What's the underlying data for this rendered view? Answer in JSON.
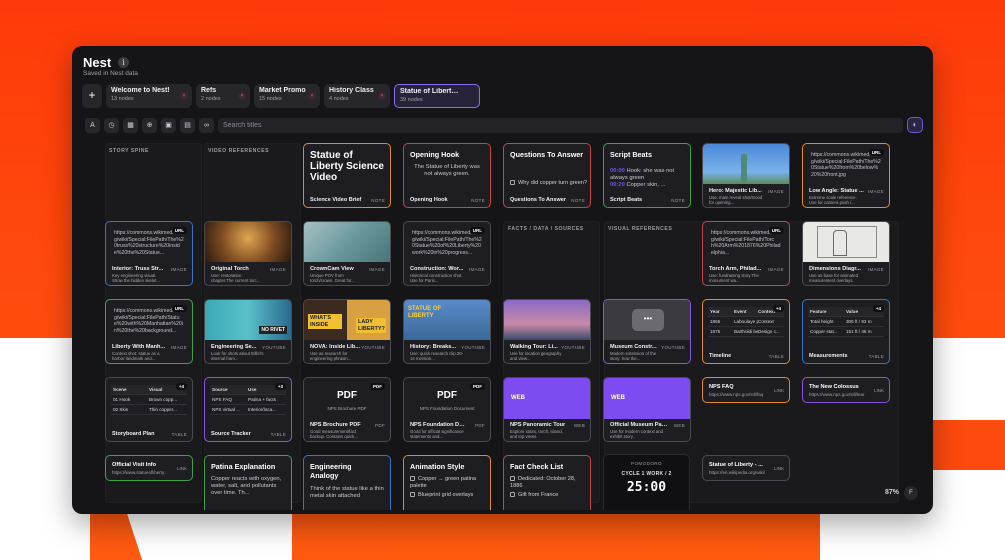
{
  "app": {
    "title": "Nest",
    "info_icon": "info-icon",
    "subtitle": "Saved in Nest data"
  },
  "tabs": {
    "add_label": "+",
    "items": [
      {
        "name": "Welcome to Nest!",
        "count": "13 nodes"
      },
      {
        "name": "Refs",
        "count": "2 nodes"
      },
      {
        "name": "Market Promo",
        "count": "15 nodes"
      },
      {
        "name": "History Class",
        "count": "4 nodes"
      },
      {
        "name": "Statue of Liberty...",
        "count": "39 nodes",
        "active": true
      }
    ],
    "close_glyph": "×"
  },
  "toolbar": {
    "icons": [
      "text-format-icon",
      "clock-icon",
      "table-icon",
      "globe-icon",
      "grid-icon",
      "document-icon",
      "link-icon"
    ],
    "search_placeholder": "Search titles",
    "right_icon": "palette-icon"
  },
  "lanes": {
    "story_spine": "STORY SPINE",
    "video_references": "VIDEO REFERENCES",
    "facts": "FACTS / DATA / SOURCES",
    "visual_references": "VISUAL REFERENCES"
  },
  "cards": {
    "science_brief": {
      "title": "Statue of Liberty Science Video",
      "footer": "Science Video Brief",
      "type": "NOTE"
    },
    "opening_hook": {
      "header": "Opening Hook",
      "body": "The Statue of Liberty was not always green.",
      "footer": "Opening Hook",
      "type": "NOTE"
    },
    "questions": {
      "header": "Questions To Answer",
      "check1": "Why did copper turn green?",
      "footer": "Questions To Answer",
      "type": "NOTE"
    },
    "script_beats": {
      "header": "Script Beats",
      "line1_time": "00:00",
      "line1": "Hook: she was not always green",
      "line2_time": "00:20",
      "line2": "Copper skin, ...",
      "footer": "Script Beats",
      "type": "NOTE"
    },
    "hero": {
      "title": "Hero: Majestic Lib...",
      "desc": "Use: main reveal shot/Good for opening...",
      "type": "IMAGE"
    },
    "low_angle": {
      "url": "https://commons.wikimedia.org/wiki/Special:FilePath/The%20Statue%20from%20below%20%20front.jpg",
      "badge": "URL",
      "title": "Low Angle: Statue ...",
      "desc": "Extreme scale reference. Use for camera push /...",
      "type": "IMAGE"
    },
    "interior": {
      "url": "https://commons.wikimedia.org/wiki/Special:FilePath/The%20truss%20structure%20inside%20the%20Statue...",
      "badge": "URL",
      "title": "Interior: Truss Str...",
      "desc": "Key engineering visual. Show the hidden skelet...",
      "type": "IMAGE"
    },
    "original_torch": {
      "title": "Original Torch",
      "desc": "Use: restoration chapter.The current torc...",
      "type": "IMAGE"
    },
    "crowncam": {
      "title": "CrownCam View",
      "desc": "Unique POV from torch/crown. Great for...",
      "type": "IMAGE"
    },
    "construction": {
      "url": "https://commons.wikimedia.org/wiki/Special:FilePath/The%20Statue%20of%20Liberty%20work%20in%20progress...",
      "badge": "URL",
      "title": "Construction: Wor...",
      "desc": "Historical construction shot. Use for Paris...",
      "type": "IMAGE"
    },
    "torch_arm": {
      "url": "https://commons.wikimedia.org/wiki/Special:FilePath/Torch%20Arm%201876%20Philadelphia...",
      "badge": "URL",
      "title": "Torch Arm, Philad...",
      "desc": "Use: fundraising story.The monument wa...",
      "type": "IMAGE"
    },
    "dimensions": {
      "title": "Dimensions Diagr...",
      "desc": "Use as base for animated measurement overlays.",
      "type": "IMAGE"
    },
    "liberty_manhattan": {
      "url": "https://commons.wikimedia.org/wiki/Special:FilePath/Statue%20with%20Manhattan%20in%20the%20background...",
      "badge": "URL",
      "title": "Liberty With Manh...",
      "desc": "Context shot: statue as a harbor landmark and...",
      "type": "IMAGE"
    },
    "engineering_se": {
      "title": "Engineering Se...",
      "desc": "Look for shots about Eiffel's internal fram...",
      "type": "YOUTUBE",
      "thumb_text": "NO RIVET"
    },
    "nova": {
      "title": "NOVA: Inside Lib...",
      "desc": "Use as research for engineering phrasin...",
      "type": "YOUTUBE",
      "thumb_left": "WHAT'S INSIDE",
      "thumb_right": "LADY LIBERTY?"
    },
    "history_breaks": {
      "title": "History: Breaks...",
      "desc": "Use: quick research clip.30-14 mention...",
      "type": "YOUTUBE",
      "thumb_text": "STATUE OF LIBERTY"
    },
    "walking_tour": {
      "title": "Walking Tour: Li...",
      "desc": "Use for location geography and view...",
      "type": "YOUTUBE"
    },
    "museum_constr": {
      "title": "Museum Constr...",
      "desc": "Modern extension of the story: how the...",
      "type": "YOUTUBE"
    },
    "timeline": {
      "badge": "+4",
      "headers": [
        "Year",
        "Event",
        "Context"
      ],
      "rows": [
        [
          "1865",
          "Laboulaye p...",
          "Context"
        ],
        [
          "1875",
          "Bartholdi be...",
          "Design c..."
        ]
      ],
      "footer": "Timeline",
      "type": "TABLE"
    },
    "measurements": {
      "badge": "+4",
      "headers": [
        "Feature",
        "Value"
      ],
      "rows": [
        [
          "Total height",
          "305 ft / 93 m"
        ],
        [
          "Copper stat...",
          "151 ft / 46 m"
        ]
      ],
      "footer": "Measurements",
      "type": "TABLE"
    },
    "storyboard": {
      "badge": "+4",
      "headers": [
        "Scene",
        "Visual"
      ],
      "rows": [
        [
          "01 Hook",
          "Brown copp..."
        ],
        [
          "02 Skin",
          "Thin copper..."
        ]
      ],
      "footer": "Storyboard Plan",
      "type": "TABLE"
    },
    "source_tracker": {
      "badge": "+3",
      "headers": [
        "Source",
        "Use"
      ],
      "rows": [
        [
          "NPS FAQ",
          "Patina + facts"
        ],
        [
          "NPS virtual ...",
          "Interior/loca..."
        ]
      ],
      "footer": "Source Tracker",
      "type": "TABLE"
    },
    "nps_brochure": {
      "pdf": "PDF",
      "sub": "NPS Brochure PDF",
      "badge": "PDF",
      "title": "NPS Brochure PDF",
      "desc": "Good measurement/fact backup. Contains quick...",
      "type": "PDF"
    },
    "nps_foundation": {
      "pdf": "PDF",
      "sub": "NPS Foundation Document",
      "badge": "PDF",
      "title": "NPS Foundation Doc...",
      "desc": "Good for official significance statements and...",
      "type": "PDF"
    },
    "nps_panoramic": {
      "web": "WEB",
      "title": "NPS Panoramic Tour",
      "desc": "Explore stairs, torch, island, and top views.",
      "type": "WEB"
    },
    "official_museum": {
      "web": "WEB",
      "title": "Official Museum Page",
      "desc": "Use for modern context and exhibit story.",
      "type": "WEB"
    },
    "nps_faq": {
      "title": "NPS FAQ",
      "url": "https://www.nps.gov/stli/faq",
      "type": "LINK"
    },
    "new_colossus": {
      "title": "The New Colossus",
      "url": "https://www.nps.gov/stli/lear",
      "type": "LINK"
    },
    "official_visit": {
      "title": "Official Visit Info",
      "url": "https://www.statueofliberty...",
      "type": "LINK"
    },
    "wiki_link": {
      "title": "Statue of Liberty - ...",
      "url": "https://en.wikipedia.org/wiki/",
      "type": "LINK"
    },
    "patina": {
      "header": "Patina Explanation",
      "body": "Copper reacts with oxygen, water, salt, and pollutants over time. Th..."
    },
    "eng_analogy": {
      "header": "Engineering Analogy",
      "body": "Think of the statue like a thin metal skin attached"
    },
    "animation_style": {
      "header": "Animation Style",
      "check1": "Copper → green patina palette",
      "check2": "Blueprint grid overlays"
    },
    "fact_check": {
      "header": "Fact Check List",
      "check1": "Dedicated: October 28, 1886",
      "check2": "Gift from France"
    }
  },
  "pomodoro": {
    "label": "POMODORO",
    "cycle": "CYCLE 1 WORK / 2",
    "time": "25:00"
  },
  "zoom": {
    "level": "87%",
    "button": "F"
  }
}
